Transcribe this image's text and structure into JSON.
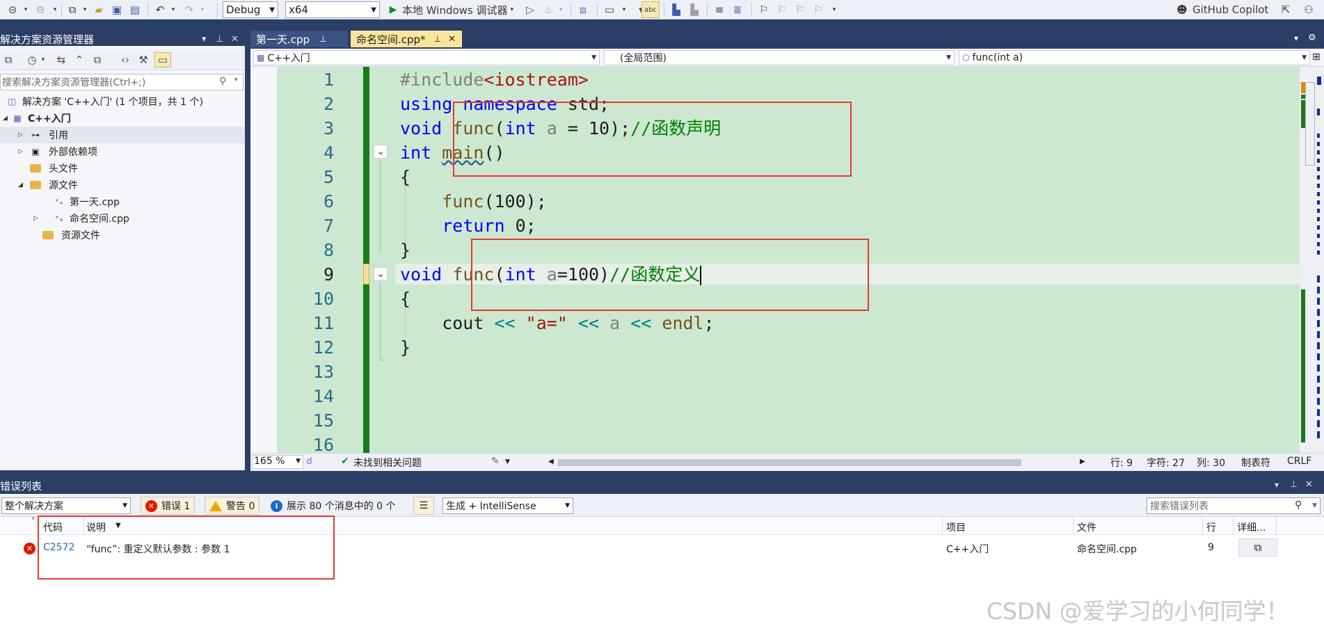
{
  "toolbar": {
    "config": "Debug",
    "platform": "x64",
    "run_label": "本地 Windows 调试器",
    "copilot_label": "GitHub Copilot"
  },
  "solution_explorer": {
    "title": "解决方案资源管理器",
    "search_placeholder": "搜索解决方案资源管理器(Ctrl+;)",
    "items": [
      {
        "label": "解决方案 'C++入门' (1 个项目，共 1 个)"
      },
      {
        "label": "C++入门"
      },
      {
        "label": "引用"
      },
      {
        "label": "外部依赖项"
      },
      {
        "label": "头文件"
      },
      {
        "label": "源文件"
      },
      {
        "label": "第一天.cpp"
      },
      {
        "label": "命名空间.cpp"
      },
      {
        "label": "资源文件"
      }
    ]
  },
  "editor": {
    "tabs": [
      {
        "label": "第一天.cpp"
      },
      {
        "label": "命名空间.cpp*"
      }
    ],
    "nav": {
      "project": "C++入门",
      "scope": "(全局范围)",
      "member": "func(int a)"
    },
    "line_numbers": [
      "1",
      "2",
      "3",
      "4",
      "5",
      "6",
      "7",
      "8",
      "9",
      "10",
      "11",
      "12",
      "13",
      "14",
      "15",
      "16"
    ],
    "status": {
      "zoom": "165 %",
      "issues": "未找到相关问题",
      "line": "行: 9",
      "char": "字符: 27",
      "col": "列: 30",
      "tabs": "制表符",
      "eol": "CRLF"
    }
  },
  "error_list": {
    "title": "错误列表",
    "scope_filter": "整个解决方案",
    "errors_btn": "错误 1",
    "warnings_btn": "警告 0",
    "messages_btn": "展示 80 个消息中的 0 个",
    "build_filter": "生成 + IntelliSense",
    "search_placeholder": "搜索错误列表",
    "columns": [
      "代码",
      "说明",
      "项目",
      "文件",
      "行",
      "详细..."
    ],
    "rows": [
      {
        "code": "C2572",
        "description": "“func”: 重定义默认参数 : 参数 1",
        "project": "C++入门",
        "file": "命名空间.cpp",
        "line": "9"
      }
    ]
  },
  "watermark": "CSDN @爱学习的小何同学！",
  "colors": {
    "accent": "#2b3e66",
    "editor_bg": "#cde8d0",
    "error": "#e51400",
    "highlight_box": "#e53935"
  }
}
